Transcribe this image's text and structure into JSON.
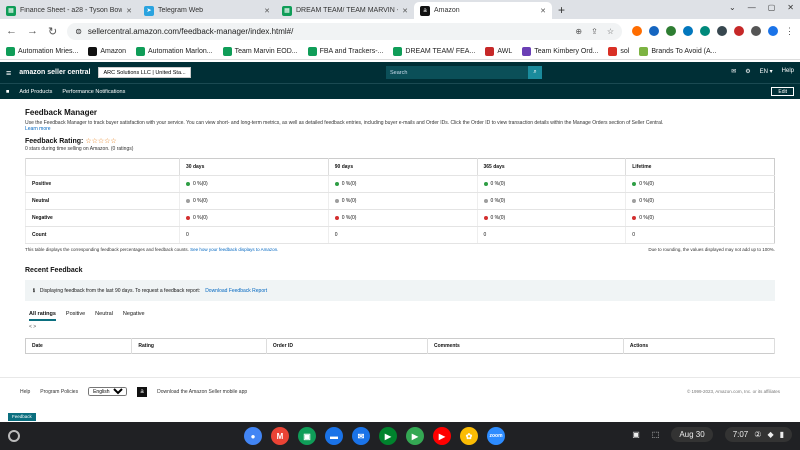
{
  "browser": {
    "tabs": [
      {
        "title": "Finance Sheet - a28 - Tyson Bow",
        "icon": "sheets-icon",
        "color": "#0f9d58",
        "glyph": "▦"
      },
      {
        "title": "Telegram Web",
        "icon": "telegram-icon",
        "color": "#2aa3df",
        "glyph": "➤"
      },
      {
        "title": "DREAM TEAM/ TEAM MARVIN -",
        "icon": "sheets-icon",
        "color": "#0f9d58",
        "glyph": "▦"
      },
      {
        "title": "Amazon",
        "icon": "amazon-icon",
        "color": "#111111",
        "glyph": "a"
      }
    ],
    "new_tab_label": "+",
    "url": "sellercentral.amazon.com/feedback-manager/index.html#/",
    "bookmarks": [
      {
        "label": "Automation Mries...",
        "color": "#0f9d58"
      },
      {
        "label": "Amazon",
        "color": "#111111"
      },
      {
        "label": "Automation Marlon...",
        "color": "#0f9d58"
      },
      {
        "label": "Team Marvin EOD...",
        "color": "#0f9d58"
      },
      {
        "label": "FBA and Trackers-...",
        "color": "#0f9d58"
      },
      {
        "label": "DREAM TEAM/ FEA...",
        "color": "#0f9d58"
      },
      {
        "label": "AWL",
        "color": "#c62828"
      },
      {
        "label": "Team Kimbery Ord...",
        "color": "#6a3fb5"
      },
      {
        "label": "sol",
        "color": "#d93025"
      },
      {
        "label": "Brands To Avoid (A...",
        "color": "#7cb342"
      }
    ]
  },
  "seller": {
    "logo": "amazon seller central",
    "account": "ARC Solutions LLC | United Sta...",
    "search_placeholder": "Search",
    "lang": "EN ▾",
    "help": "Help",
    "subnav": [
      "Add Products",
      "Performance Notifications"
    ],
    "edit": "Edit"
  },
  "page": {
    "title": "Feedback Manager",
    "description": "Use the Feedback Manager to track buyer satisfaction with your service. You can view short- and long-term metrics, as well as detailed feedback entries, including buyer e-mails and Order IDs. Click the Order ID to view transaction details within the Manage Orders section of Seller Central.",
    "learn_more": "Learn more",
    "rating_label": "Feedback Rating:",
    "stars": "☆☆☆☆☆",
    "rating_sub": "0 stars during time selling on Amazon. (0 ratings)"
  },
  "feedback_table": {
    "headers": [
      "",
      "30 days",
      "90 days",
      "365 days",
      "Lifetime"
    ],
    "rows": [
      {
        "label": "Positive",
        "color": "#2e9e44",
        "values": [
          "0 %(0)",
          "0 %(0)",
          "0 %(0)",
          "0 %(0)"
        ]
      },
      {
        "label": "Neutral",
        "color": "#9e9e9e",
        "values": [
          "0 %(0)",
          "0 %(0)",
          "0 %(0)",
          "0 %(0)"
        ]
      },
      {
        "label": "Negative",
        "color": "#d32f2f",
        "values": [
          "0 %(0)",
          "0 %(0)",
          "0 %(0)",
          "0 %(0)"
        ]
      },
      {
        "label": "Count",
        "color": "",
        "values": [
          "0",
          "0",
          "0",
          "0"
        ]
      }
    ],
    "note_left": "This table displays the corresponding feedback percentages and feedback counts.",
    "note_link": "See how your feedback displays to Amazon.",
    "note_right": "Due to rounding, the values displayed may not add up to 100%."
  },
  "recent": {
    "title": "Recent Feedback",
    "info": "Displaying feedback from the last 90 days. To request a feedback report:",
    "info_link": "Download Feedback Report",
    "tabs": [
      "All ratings",
      "Positive",
      "Neutral",
      "Negative"
    ],
    "pager": "<   >",
    "columns": [
      "Date",
      "Rating",
      "Order ID",
      "Comments",
      "Actions"
    ]
  },
  "footer": {
    "help": "Help",
    "policies": "Program Policies",
    "language": "English",
    "app": "Download the Amazon Seller mobile app",
    "copyright": "© 1999-2023, Amazon.com, Inc. or its affiliates",
    "feedback_tag": "Feedback"
  },
  "taskbar": {
    "apps": [
      {
        "name": "chrome-icon",
        "color": "#4285f4",
        "glyph": "●"
      },
      {
        "name": "gmail-icon",
        "color": "#ea4335",
        "glyph": "M"
      },
      {
        "name": "classroom-icon",
        "color": "#0f9d58",
        "glyph": "▣"
      },
      {
        "name": "files-icon",
        "color": "#1a73e8",
        "glyph": "▬"
      },
      {
        "name": "messages-icon",
        "color": "#1a73e8",
        "glyph": "✉"
      },
      {
        "name": "meet-icon",
        "color": "#00832d",
        "glyph": "▶"
      },
      {
        "name": "play-store-icon",
        "color": "#34a853",
        "glyph": "▶"
      },
      {
        "name": "youtube-icon",
        "color": "#ff0000",
        "glyph": "▶"
      },
      {
        "name": "photos-icon",
        "color": "#fbbc04",
        "glyph": "✿"
      },
      {
        "name": "zoom-icon",
        "color": "#2d8cff",
        "glyph": "zoom"
      }
    ],
    "date": "Aug 30",
    "time": "7:07"
  }
}
